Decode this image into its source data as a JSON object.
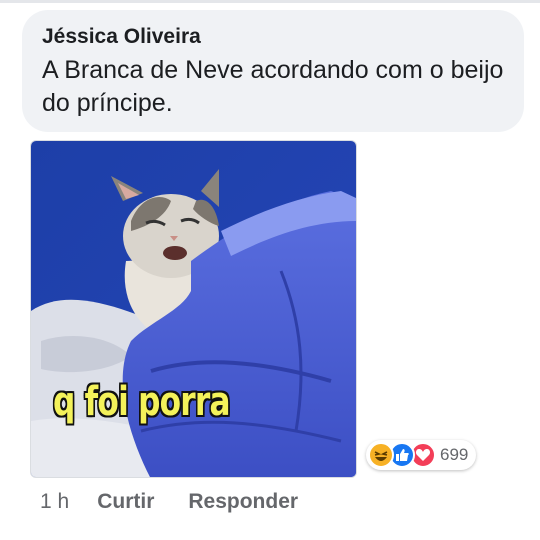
{
  "comment": {
    "author": "Jéssica Oliveira",
    "text": "A Branca de Neve acordando com o beijo do príncipe."
  },
  "attachment": {
    "caption": "q foi porra"
  },
  "reactions": {
    "icons": [
      "haha-icon",
      "like-icon",
      "love-icon"
    ],
    "count": "699"
  },
  "actions": {
    "time": "1 h",
    "like_label": "Curtir",
    "reply_label": "Responder"
  },
  "colors": {
    "bubble": "#f0f2f5",
    "secondary_text": "#65676b",
    "like": "#1877f2",
    "love": "#f33e58",
    "haha": "#f7b125"
  }
}
